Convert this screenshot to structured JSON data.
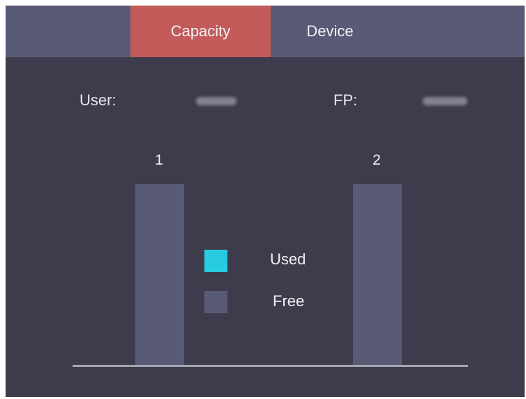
{
  "tabs": [
    {
      "label": "Capacity",
      "active": true
    },
    {
      "label": "Device",
      "active": false
    }
  ],
  "stats": {
    "user_label": "User:",
    "fp_label": "FP:"
  },
  "chart_data": {
    "type": "bar",
    "categories": [
      "1",
      "2"
    ],
    "series": [
      {
        "name": "Used",
        "values": [
          0,
          0
        ]
      },
      {
        "name": "Free",
        "values": [
          100,
          100
        ]
      }
    ],
    "ylim": [
      0,
      100
    ],
    "legend": "center",
    "grid": false
  },
  "legend": {
    "used_label": "Used",
    "free_label": "Free"
  },
  "colors": {
    "background": "#3e3c4c",
    "tabbar": "#585a76",
    "active_tab": "#c25b5a",
    "used": "#27cce0",
    "free": "#585a76",
    "text": "#f0f0f4"
  }
}
